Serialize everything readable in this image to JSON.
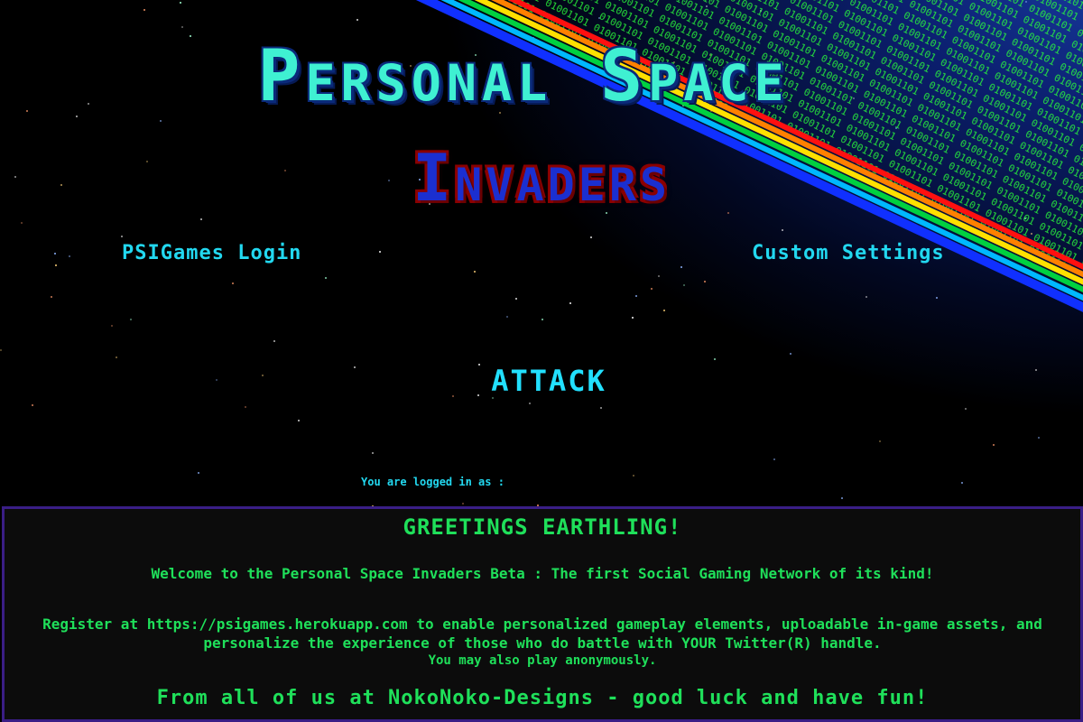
{
  "title": {
    "main": "Personal Space",
    "sub": "Invaders"
  },
  "menu": {
    "login_label": "PSIGames Login",
    "settings_label": "Custom Settings",
    "attack_label": "ATTACK"
  },
  "status": {
    "logged_in_as": "You are logged in as :"
  },
  "info_panel": {
    "greeting": "GREETINGS EARTHLING!",
    "welcome": "Welcome to the Personal Space Invaders Beta : The first Social Gaming Network of its kind!",
    "register": "Register at https://psigames.herokuapp.com to enable personalized gameplay elements, uploadable in-game assets, and personalize the experience of those who do battle with YOUR Twitter(R) handle.",
    "anonymous": "You may also play anonymously.",
    "farewell": "From all of us at NokoNoko-Designs - good luck and have fun!"
  },
  "colors": {
    "title_main": "#3ff0d2",
    "title_sub": "#1b2fd0",
    "link": "#22d8f0",
    "panel_text": "#1fe05a",
    "panel_border": "#3a1e86"
  }
}
